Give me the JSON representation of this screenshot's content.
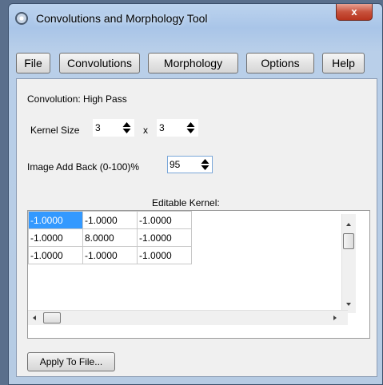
{
  "window": {
    "title": "Convolutions and Morphology Tool",
    "close_glyph": "x",
    "icon": "app-icon"
  },
  "menu": {
    "file": "File",
    "convolutions": "Convolutions",
    "morphology": "Morphology",
    "options": "Options",
    "help": "Help"
  },
  "convolution": {
    "label": "Convolution: High Pass"
  },
  "kernel_size": {
    "label": "Kernel Size",
    "width": "3",
    "separator": "x",
    "height": "3"
  },
  "add_back": {
    "label": "Image Add Back (0-100)%",
    "value": "95"
  },
  "kernel": {
    "heading": "Editable Kernel:",
    "rows": [
      [
        "-1.0000",
        "-1.0000",
        "-1.0000"
      ],
      [
        "-1.0000",
        "8.0000",
        "-1.0000"
      ],
      [
        "-1.0000",
        "-1.0000",
        "-1.0000"
      ]
    ],
    "selected_cell": [
      0,
      0
    ]
  },
  "apply_button": "Apply To File...",
  "colors": {
    "selection": "#3399ff",
    "close_button": "#c7513c",
    "frame": "#a9c5e8"
  }
}
